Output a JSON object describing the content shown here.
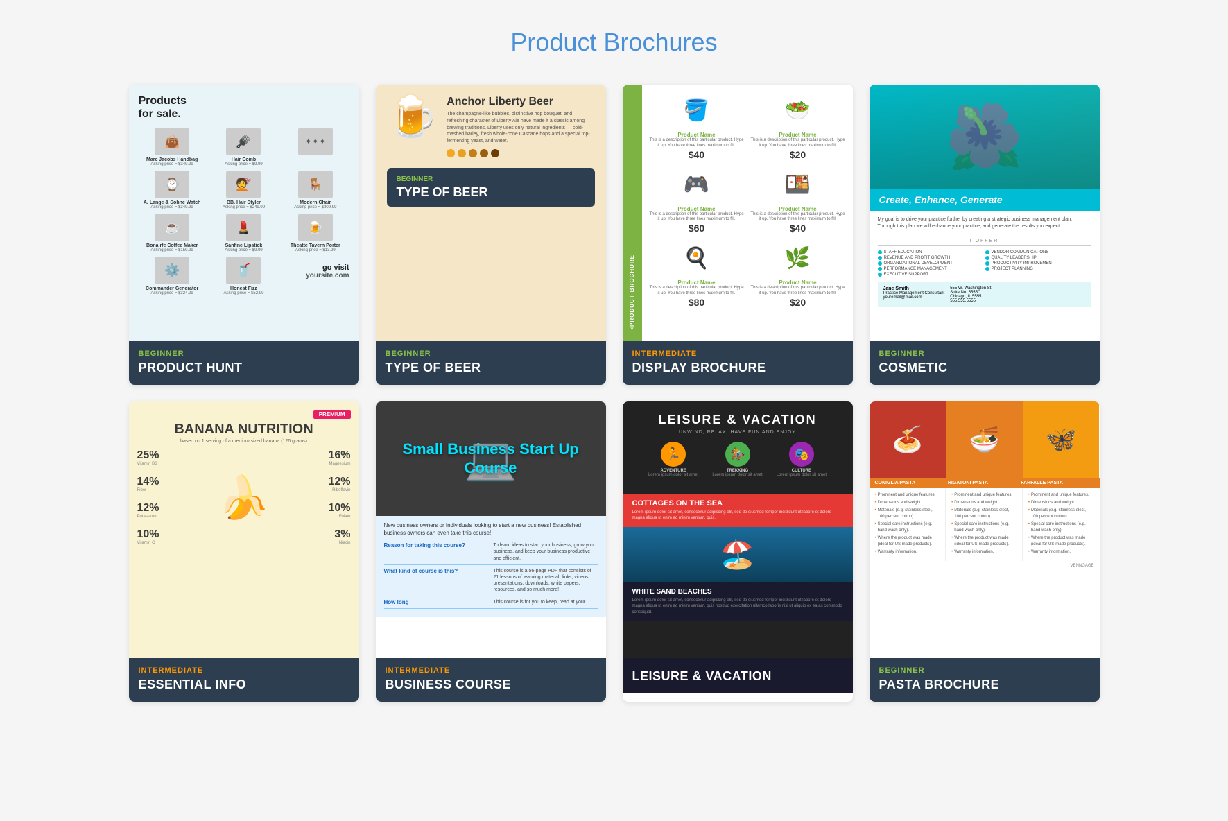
{
  "page": {
    "title": "Product Brochures"
  },
  "cards": [
    {
      "id": "product-hunt",
      "level": "BEGINNER",
      "level_class": "level-beginner",
      "name": "PRODUCT HUNT",
      "preview_title": "Products for sale.",
      "products": [
        {
          "name": "Marc Jacobs Handbag",
          "price": "Asking price = $349.99",
          "emoji": "👜"
        },
        {
          "name": "Hair Comb",
          "price": "Asking price = $9.99",
          "emoji": "🪮"
        },
        {
          "name": "A. Lange & Sohne Watch",
          "price": "Asking price = $349.99",
          "emoji": "⌚"
        },
        {
          "name": "BB. Hair Styler",
          "price": "Asking price = $249.99",
          "emoji": "💇"
        },
        {
          "name": "Modern Chair",
          "price": "Asking price = $309.99",
          "emoji": "🪑"
        },
        {
          "name": "Bonairfe Coffee Maker",
          "price": "Asking price = $159.99",
          "emoji": "☕"
        },
        {
          "name": "Sanfine Lipstick",
          "price": "Asking price = $9.99",
          "emoji": "💄"
        },
        {
          "name": "Theatte Tavern Porter",
          "price": "Asking price = $13.99",
          "emoji": "🍺"
        },
        {
          "name": "Commander Generator",
          "price": "Asking price = $324.99",
          "emoji": "⚙️"
        },
        {
          "name": "Honest Fizz",
          "price": "Asking price = $52.99",
          "emoji": "🥤"
        }
      ],
      "goto_text": "go visit",
      "goto_url": "yoursite.com"
    },
    {
      "id": "anchor-liberty-beer",
      "level": "BEGINNER",
      "level_class": "level-beginner",
      "name": "TYPE OF BEER",
      "beer_name": "Anchor Liberty Beer",
      "beer_desc": "The champagne-like bubbles, distinctive hop bouquet, and refreshing character of Liberty Ale have made it a classic among brewing traditions. Liberty uses only natural ingredients — cold-mashed barley, fresh whole-cone Cascade hops and a special top-fermenting yeast, and water.",
      "dots": [
        "#f5a623",
        "#e8a020",
        "#c47d1a",
        "#9a5e10",
        "#6b3e08"
      ],
      "type_label": "BEGINNER",
      "type_name": "TYPE OF BEER"
    },
    {
      "id": "display-brochure",
      "level": "INTERMEDIATE",
      "level_class": "level-intermediate",
      "name": "DISPLAY BROCHURE",
      "sidebar_text": "Product Brochure",
      "products": [
        {
          "name": "Product Name",
          "desc": "This is a description of this particular product. Hype it up. You have three lines maximum to fill.",
          "price": "$40",
          "emoji": "🪣"
        },
        {
          "name": "Product Name",
          "desc": "This is a description of this particular product. Hype it up. You have three lines maximum to fill.",
          "price": "$20",
          "emoji": "🥗"
        },
        {
          "name": "Product Name",
          "desc": "This is a description of this particular product. Hype it up. You have three lines maximum to fill.",
          "price": "$60",
          "emoji": "🎮"
        },
        {
          "name": "Product Name",
          "desc": "This is a description of this particular product. Hype it up. You have three lines maximum to fill.",
          "price": "$40",
          "emoji": "🍱"
        },
        {
          "name": "Product Name",
          "desc": "This is a description of this particular product. Hype it up. You have three lines maximum to fill.",
          "price": "$80",
          "emoji": "🍳"
        },
        {
          "name": "Product Name",
          "desc": "This is a description of this particular product. Hype it up. You have three lines maximum to fill.",
          "price": "$20",
          "emoji": "🌿"
        }
      ]
    },
    {
      "id": "cosmetic",
      "level": "BEGINNER",
      "level_class": "level-beginner",
      "name": "COSMETIC",
      "tagline": "Create, Enhance, Generate",
      "desc": "My goal is to drive your practice further by creating a strategic business management plan. Through this plan we will enhance your practice, and generate the results you expect.",
      "offer_title": "I OFFER",
      "services": [
        "STAFF EDUCATION",
        "VENDOR COMMUNICATIONS",
        "REVENUE AND PROFIT GROWTH",
        "QUALITY LEADERSHIP",
        "ORGANIZATIONAL DEVELOPMENT",
        "PRODUCTIVITY IMPROVEMENT",
        "PERFORMANCE MANAGEMENT",
        "PROJECT PLANNING",
        "EXECUTIVE SUPPORT"
      ],
      "contact_name": "Jane Smith",
      "contact_title": "Practice Management Consultant",
      "contact_email": "youremail@mail.com",
      "contact_address": "555 W. Washington St. Suite No. 5555\nChicago, IL 5555\n555.555.5555"
    },
    {
      "id": "essential-info",
      "level": "INTERMEDIATE",
      "level_class": "level-intermediate",
      "name": "ESSENTIAL INFO",
      "badge": "PREMIUM",
      "badge_class": "level-premium",
      "title": "BANANA NUTRITION",
      "subtitle": "based on 1 serving of a medium sized banana (126 grams)",
      "stats_left": [
        {
          "pct": "25%",
          "label": "Vitamin B6"
        },
        {
          "pct": "14%",
          "label": "Fiber"
        },
        {
          "pct": "12%",
          "label": "Potassium"
        },
        {
          "pct": "10%",
          "label": "Vitamin C"
        }
      ],
      "stats_right": [
        {
          "pct": "16%",
          "label": "Magnesium"
        },
        {
          "pct": "12%",
          "label": "Riboflavin"
        },
        {
          "pct": "10%",
          "label": "Folate"
        },
        {
          "pct": "3%",
          "label": "Niacin"
        }
      ]
    },
    {
      "id": "business-course",
      "level": "INTERMEDIATE",
      "level_class": "level-intermediate",
      "name": "BUSINESS COURSE",
      "hero_text": "Small Business Start Up Course",
      "hero_desc": "New business owners or Individuals looking to start a new business! Established business owners can even take this course!",
      "qa": [
        {
          "question": "Reason for taking this course?",
          "answer": "To learn ideas to start your business, grow your business, and keep your business productive and efficient."
        },
        {
          "question": "What kind of course is this?",
          "answer": "This course is a 56-page PDF that consists of 21 lessons of learning material, links, videos, presentations, downloads, white papers, resources, and so much more!"
        },
        {
          "question": "How long",
          "answer": "This course is for you to keep, read at your"
        }
      ]
    },
    {
      "id": "leisure-vacation",
      "level": "",
      "level_class": "",
      "name": "LEISURE & VACATION",
      "title": "LEISURE & VACATION",
      "subtitle": "UNWIND, RELAX, HAVE FUN AND ENJOY",
      "icons": [
        {
          "emoji": "🏃",
          "color": "#ff9800",
          "label": "ADVENTURE",
          "desc": "Lorem ipsum dolor sit amet"
        },
        {
          "emoji": "🏇",
          "color": "#4caf50",
          "label": "TREKKING",
          "desc": "Lorem ipsum dolor sit amet"
        },
        {
          "emoji": "🎭",
          "color": "#9c27b0",
          "label": "CULTURE",
          "desc": "Lorem ipsum dolor sit amet"
        }
      ],
      "section1_title": "COTTAGES ON THE SEA",
      "section1_text": "Lorem ipsum dolor sit amet, consectetur adipiscing elit, sed do eiusmod tempor incididunt ut labore et dolore magna aliqua ut enim ad minim veniam, quis.",
      "section2_title": "WHITE SAND BEACHES",
      "section2_text": "Lorem ipsum dolor sit amet, consectetur adipiscing elit, sed do eiusmod tempor incididunt ut labore et dolore magna aliqua ut enim ad minim veniam, quis nostrud exercitation ullamco laboris nisi ut aliquip ex ea as commodo consequat."
    },
    {
      "id": "pasta-brochure",
      "level": "BEGINNER",
      "level_class": "level-beginner",
      "name": "PASTA BROCHURE",
      "pastas": [
        {
          "name": "CONIGLIA PASTA",
          "emoji": "🍝",
          "color": "#c0392b",
          "features": [
            "Prominent and unique features.",
            "Dimensions and weight.",
            "Materials (e.g. stainless steel, 100 percent cotton).",
            "Special care instructions (e.g. hand wash only).",
            "Where the product was made (ideal for US made products).",
            "Warranty information."
          ]
        },
        {
          "name": "RIGATONI PASTA",
          "emoji": "🍜",
          "color": "#e67e22",
          "features": [
            "Prominent and unique features.",
            "Dimensions and weight.",
            "Materials (e.g. stainless elect, 100 percent cotton).",
            "Special care instructions (e.g. hand wash only).",
            "Where the product was made (ideal for US-made products).",
            "Warranty information."
          ]
        },
        {
          "name": "FARFALLE PASTA",
          "emoji": "🦋",
          "color": "#f39c12",
          "features": [
            "Prominent and unique features.",
            "Dimensions and weight.",
            "Materials (e.g. stainless elect, 100 percent cotton).",
            "Special care instructions (e.g. hand wash only).",
            "Where the product was made (ideal for US-made products).",
            "Warranty information."
          ]
        }
      ],
      "logo": "VENNGAGE"
    }
  ]
}
